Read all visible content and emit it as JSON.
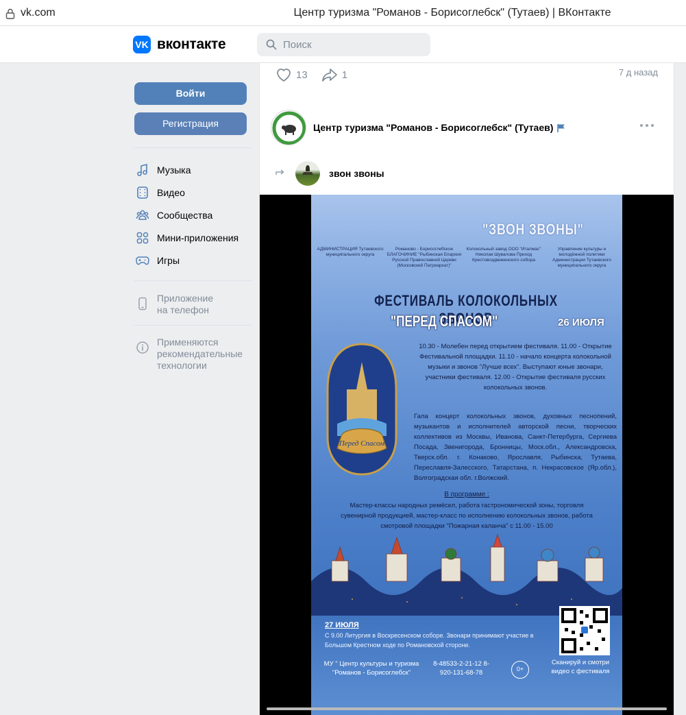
{
  "browser": {
    "url": "vk.com",
    "title": "Центр туризма \"Романов - Борисоглебск\" (Тутаев) | ВКонтакте"
  },
  "header": {
    "logo_text": "вконтакте",
    "search_placeholder": "Поиск"
  },
  "sidebar": {
    "login_label": "Войти",
    "register_label": "Регистрация",
    "items": [
      {
        "label": "Музыка",
        "icon": "music-icon"
      },
      {
        "label": "Видео",
        "icon": "video-icon"
      },
      {
        "label": "Сообщества",
        "icon": "communities-icon"
      },
      {
        "label": "Мини-приложения",
        "icon": "apps-icon"
      },
      {
        "label": "Игры",
        "icon": "gamepad-icon"
      }
    ],
    "app_promo": {
      "line1": "Приложение",
      "line2": "на телефон"
    },
    "recs_note": {
      "line1": "Применяются",
      "line2": "рекомендательные",
      "line3": "технологии"
    }
  },
  "feed": {
    "prev_post": {
      "likes": "13",
      "shares": "1",
      "time": "7 д назад"
    },
    "post": {
      "author": "Центр туризма \"Романов - Борисоглебск\" (Тутаев)",
      "repost_source": "звон звоны",
      "poster": {
        "title": "\"ЗВОН ЗВОНЫ\"",
        "orgs": [
          "АДМИНИСТРАЦИЯ Тутаевского муниципального округа",
          "Романово - Борисоглебское БЛАГОЧИНИЕ \"Рыбинская Епархия Русской Православной Церкви (Московский Патриархат)\"",
          "Колокольный завод ООО \"Италмас\" Николая Шувалова Приход Крестовоздвиженского собора",
          "Управление культуры и молодёжной политики Администрации Тутаевского муниципального округа"
        ],
        "festival": "ФЕСТИВАЛЬ КОЛОКОЛЬНЫХ ЗВОНОВ",
        "festival_name": "\"ПЕРЕД СПАСОМ\"",
        "date": "26 ИЮЛЯ",
        "schedule": "10.30 - Молебен перед открытием фестиваля. 11.00 - Открытие Фестивальной площадки. 11.10 - начало концерта колокольной музыки и звонов \"Лучше всех\". Выступают юные звонари, участники фестиваля. 12.00 - Открытие фестиваля русских колокольных звонов.",
        "gala": "Гала концерт колокольных звонов, духовных песнопений, музыкантов и исполнителей авторской песни, творческих коллективов из Москвы, Иванова, Санкт-Петербурга, Сергиева Посада, Звенигорода, Бронницы, Моск.обл., Александровска, Тверск.обл. г. Конаково, Ярославля, Рыбинска, Тутаева, Переславля-Залесского, Татарстана, п. Некрасовское (Яр.обл.), Волгоградская обл. г.Волжский.",
        "program_heading": "В программе :",
        "program": "Мастер-классы народных ремёсел, работа гастрономической зоны, торговля сувенирной продукцией, мастер-класс по исполнению колокольных звонов, работа смотровой площадки \"Пожарная каланча\" с 11.00 - 15.00",
        "july_heading": "27 ИЮЛЯ",
        "july_text": "С 9.00 Литургия в Воскресенском соборе. Звонари принимают участие в Большом Крестном ходе по Романовской стороне.",
        "contact": "МУ \" Центр культуры и туризма \"Романов - Борисоглебск\"",
        "phones": "8-48533-2-21-12 8-920-131-68-78",
        "age": "0+",
        "scan": "Сканируй и смотри видео с фестиваля",
        "emblem_text": "Перед Спасом"
      }
    }
  },
  "colors": {
    "vk_blue": "#0077ff",
    "button_blue": "#5181b8",
    "muted": "#818c99"
  }
}
